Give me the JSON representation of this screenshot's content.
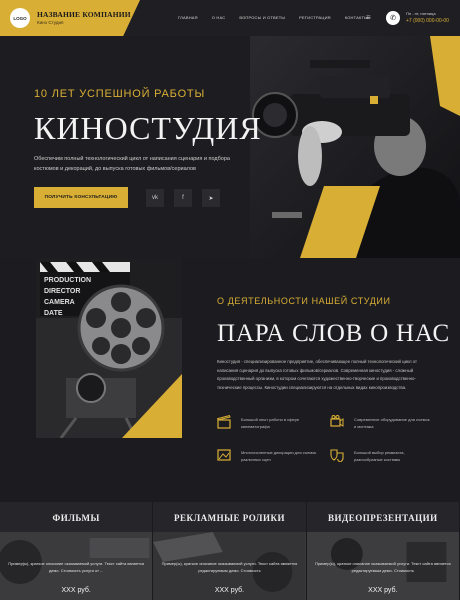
{
  "header": {
    "logo": "LOGO",
    "company_name": "НАЗВАНИЕ КОМПАНИИ",
    "company_sub": "Кино Студия",
    "nav": [
      "ГЛАВНАЯ",
      "О НАС",
      "ВОПРОСЫ И ОТВЕТЫ",
      "РЕГИСТРАЦИЯ",
      "КОНТАКТЫ"
    ],
    "menu_icon": "≡",
    "phone_icon": "✆",
    "hours": "Пн - пт, пятница",
    "phone": "+7 (000) 000-00-00"
  },
  "hero": {
    "tagline": "10 ЛЕТ УСПЕШНОЙ РАБОТЫ",
    "title": "КИНОСТУДИЯ",
    "description": "Обеспечим полный технологический цикл от написания сценария и подбора костюмов и декораций, до выпуска готовых фильмов/сериалов",
    "cta": "ПОЛУЧИТЬ КОНСУЛЬТАЦИЮ",
    "social": [
      {
        "name": "vk-icon",
        "glyph": "vk"
      },
      {
        "name": "facebook-icon",
        "glyph": "f"
      },
      {
        "name": "telegram-icon",
        "glyph": "➤"
      }
    ]
  },
  "about": {
    "tag": "О ДЕЯТЕЛЬНОСТИ НАШЕЙ СТУДИИ",
    "title": "ПАРА СЛОВ О НАС",
    "text": "Киностудия - специализированное предприятие, обеспечивающее полный технологический цикл от написания сценария до выпуска готовых фильмов/сериалов. Современная киностудия - сложный производственный организм, в котором сочетаются художественно-творческие и производственно-технические процессы. Киностудии специализируются на отдельных видах кинопроизводства.",
    "features": [
      {
        "icon": "clapperboard-icon",
        "text": "Большой опыт работы в сфере кинематографа"
      },
      {
        "icon": "camera-icon",
        "text": "Современное оборудование для съемок и монтажа"
      },
      {
        "icon": "scenery-icon",
        "text": "Многочисленные декорации для съемок различных сцен"
      },
      {
        "icon": "theater-masks-icon",
        "text": "Большой выбор реквизита, разнообразные костюмы"
      }
    ],
    "image_labels": [
      "PRODUCTION",
      "DIRECTOR",
      "CAMERA",
      "DATE"
    ]
  },
  "cards": [
    {
      "title": "ФИЛЬМЫ",
      "text": "Пример(ы), краткое описание оказываемой услуги. Текст сайта является демо. Стоимость услуги от ...",
      "price": "XXX руб."
    },
    {
      "title": "РЕКЛАМНЫЕ РОЛИКИ",
      "text": "Пример(ы), краткое описание оказываемой услуги. Текст сайта является редактируемым демо. Стоимость",
      "price": "XXX руб."
    },
    {
      "title": "ВИДЕОПРЕЗЕНТАЦИИ",
      "text": "Пример(ы), краткое описание оказываемой услуги. Текст сайта является редактируемым демо. Стоимость",
      "price": "XXX руб."
    }
  ],
  "colors": {
    "accent": "#d9ae35",
    "background": "#1c1c20",
    "text": "#f3f3f3"
  }
}
